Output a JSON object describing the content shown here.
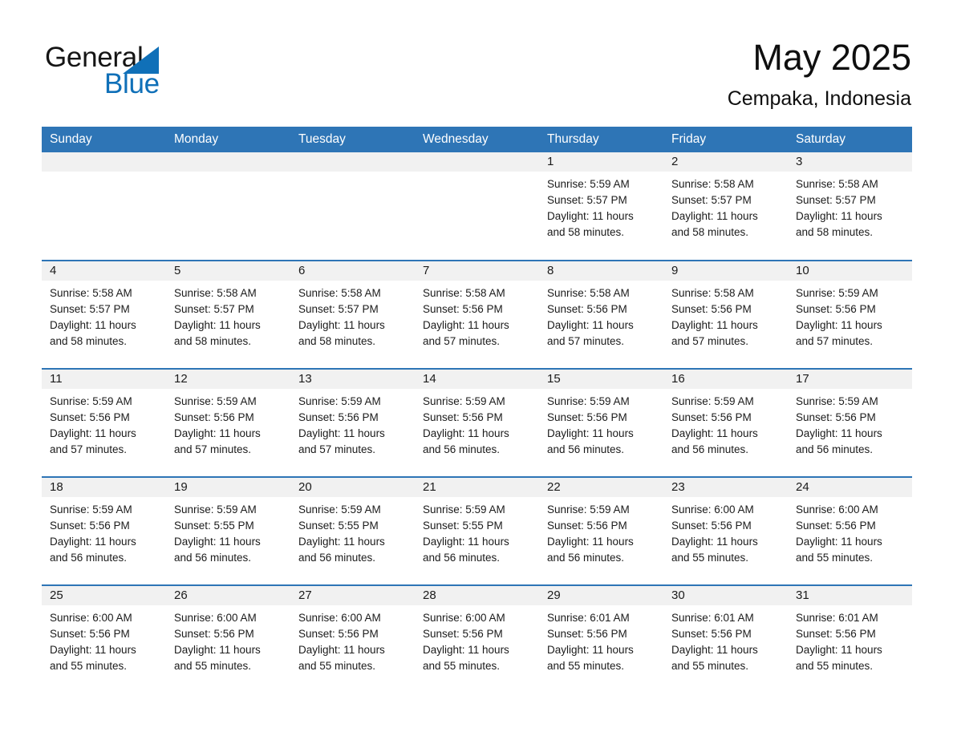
{
  "brand": {
    "name_part1": "General",
    "name_part2": "Blue",
    "triangle_icon": "triangle-icon",
    "accent_color": "#1070b8"
  },
  "header": {
    "title": "May 2025",
    "location": "Cempaka, Indonesia"
  },
  "theme": {
    "header_bar": "#2e75b6",
    "daynum_strip": "#f1f1f1",
    "row_divider": "#2e75b6",
    "text": "#1b1b1b"
  },
  "weekday_headers": [
    "Sunday",
    "Monday",
    "Tuesday",
    "Wednesday",
    "Thursday",
    "Friday",
    "Saturday"
  ],
  "weeks": [
    [
      {
        "day": "",
        "sunrise": "",
        "sunset": "",
        "daylight": ""
      },
      {
        "day": "",
        "sunrise": "",
        "sunset": "",
        "daylight": ""
      },
      {
        "day": "",
        "sunrise": "",
        "sunset": "",
        "daylight": ""
      },
      {
        "day": "",
        "sunrise": "",
        "sunset": "",
        "daylight": ""
      },
      {
        "day": "1",
        "sunrise": "Sunrise: 5:59 AM",
        "sunset": "Sunset: 5:57 PM",
        "daylight": "Daylight: 11 hours and 58 minutes."
      },
      {
        "day": "2",
        "sunrise": "Sunrise: 5:58 AM",
        "sunset": "Sunset: 5:57 PM",
        "daylight": "Daylight: 11 hours and 58 minutes."
      },
      {
        "day": "3",
        "sunrise": "Sunrise: 5:58 AM",
        "sunset": "Sunset: 5:57 PM",
        "daylight": "Daylight: 11 hours and 58 minutes."
      }
    ],
    [
      {
        "day": "4",
        "sunrise": "Sunrise: 5:58 AM",
        "sunset": "Sunset: 5:57 PM",
        "daylight": "Daylight: 11 hours and 58 minutes."
      },
      {
        "day": "5",
        "sunrise": "Sunrise: 5:58 AM",
        "sunset": "Sunset: 5:57 PM",
        "daylight": "Daylight: 11 hours and 58 minutes."
      },
      {
        "day": "6",
        "sunrise": "Sunrise: 5:58 AM",
        "sunset": "Sunset: 5:57 PM",
        "daylight": "Daylight: 11 hours and 58 minutes."
      },
      {
        "day": "7",
        "sunrise": "Sunrise: 5:58 AM",
        "sunset": "Sunset: 5:56 PM",
        "daylight": "Daylight: 11 hours and 57 minutes."
      },
      {
        "day": "8",
        "sunrise": "Sunrise: 5:58 AM",
        "sunset": "Sunset: 5:56 PM",
        "daylight": "Daylight: 11 hours and 57 minutes."
      },
      {
        "day": "9",
        "sunrise": "Sunrise: 5:58 AM",
        "sunset": "Sunset: 5:56 PM",
        "daylight": "Daylight: 11 hours and 57 minutes."
      },
      {
        "day": "10",
        "sunrise": "Sunrise: 5:59 AM",
        "sunset": "Sunset: 5:56 PM",
        "daylight": "Daylight: 11 hours and 57 minutes."
      }
    ],
    [
      {
        "day": "11",
        "sunrise": "Sunrise: 5:59 AM",
        "sunset": "Sunset: 5:56 PM",
        "daylight": "Daylight: 11 hours and 57 minutes."
      },
      {
        "day": "12",
        "sunrise": "Sunrise: 5:59 AM",
        "sunset": "Sunset: 5:56 PM",
        "daylight": "Daylight: 11 hours and 57 minutes."
      },
      {
        "day": "13",
        "sunrise": "Sunrise: 5:59 AM",
        "sunset": "Sunset: 5:56 PM",
        "daylight": "Daylight: 11 hours and 57 minutes."
      },
      {
        "day": "14",
        "sunrise": "Sunrise: 5:59 AM",
        "sunset": "Sunset: 5:56 PM",
        "daylight": "Daylight: 11 hours and 56 minutes."
      },
      {
        "day": "15",
        "sunrise": "Sunrise: 5:59 AM",
        "sunset": "Sunset: 5:56 PM",
        "daylight": "Daylight: 11 hours and 56 minutes."
      },
      {
        "day": "16",
        "sunrise": "Sunrise: 5:59 AM",
        "sunset": "Sunset: 5:56 PM",
        "daylight": "Daylight: 11 hours and 56 minutes."
      },
      {
        "day": "17",
        "sunrise": "Sunrise: 5:59 AM",
        "sunset": "Sunset: 5:56 PM",
        "daylight": "Daylight: 11 hours and 56 minutes."
      }
    ],
    [
      {
        "day": "18",
        "sunrise": "Sunrise: 5:59 AM",
        "sunset": "Sunset: 5:56 PM",
        "daylight": "Daylight: 11 hours and 56 minutes."
      },
      {
        "day": "19",
        "sunrise": "Sunrise: 5:59 AM",
        "sunset": "Sunset: 5:55 PM",
        "daylight": "Daylight: 11 hours and 56 minutes."
      },
      {
        "day": "20",
        "sunrise": "Sunrise: 5:59 AM",
        "sunset": "Sunset: 5:55 PM",
        "daylight": "Daylight: 11 hours and 56 minutes."
      },
      {
        "day": "21",
        "sunrise": "Sunrise: 5:59 AM",
        "sunset": "Sunset: 5:55 PM",
        "daylight": "Daylight: 11 hours and 56 minutes."
      },
      {
        "day": "22",
        "sunrise": "Sunrise: 5:59 AM",
        "sunset": "Sunset: 5:56 PM",
        "daylight": "Daylight: 11 hours and 56 minutes."
      },
      {
        "day": "23",
        "sunrise": "Sunrise: 6:00 AM",
        "sunset": "Sunset: 5:56 PM",
        "daylight": "Daylight: 11 hours and 55 minutes."
      },
      {
        "day": "24",
        "sunrise": "Sunrise: 6:00 AM",
        "sunset": "Sunset: 5:56 PM",
        "daylight": "Daylight: 11 hours and 55 minutes."
      }
    ],
    [
      {
        "day": "25",
        "sunrise": "Sunrise: 6:00 AM",
        "sunset": "Sunset: 5:56 PM",
        "daylight": "Daylight: 11 hours and 55 minutes."
      },
      {
        "day": "26",
        "sunrise": "Sunrise: 6:00 AM",
        "sunset": "Sunset: 5:56 PM",
        "daylight": "Daylight: 11 hours and 55 minutes."
      },
      {
        "day": "27",
        "sunrise": "Sunrise: 6:00 AM",
        "sunset": "Sunset: 5:56 PM",
        "daylight": "Daylight: 11 hours and 55 minutes."
      },
      {
        "day": "28",
        "sunrise": "Sunrise: 6:00 AM",
        "sunset": "Sunset: 5:56 PM",
        "daylight": "Daylight: 11 hours and 55 minutes."
      },
      {
        "day": "29",
        "sunrise": "Sunrise: 6:01 AM",
        "sunset": "Sunset: 5:56 PM",
        "daylight": "Daylight: 11 hours and 55 minutes."
      },
      {
        "day": "30",
        "sunrise": "Sunrise: 6:01 AM",
        "sunset": "Sunset: 5:56 PM",
        "daylight": "Daylight: 11 hours and 55 minutes."
      },
      {
        "day": "31",
        "sunrise": "Sunrise: 6:01 AM",
        "sunset": "Sunset: 5:56 PM",
        "daylight": "Daylight: 11 hours and 55 minutes."
      }
    ]
  ]
}
